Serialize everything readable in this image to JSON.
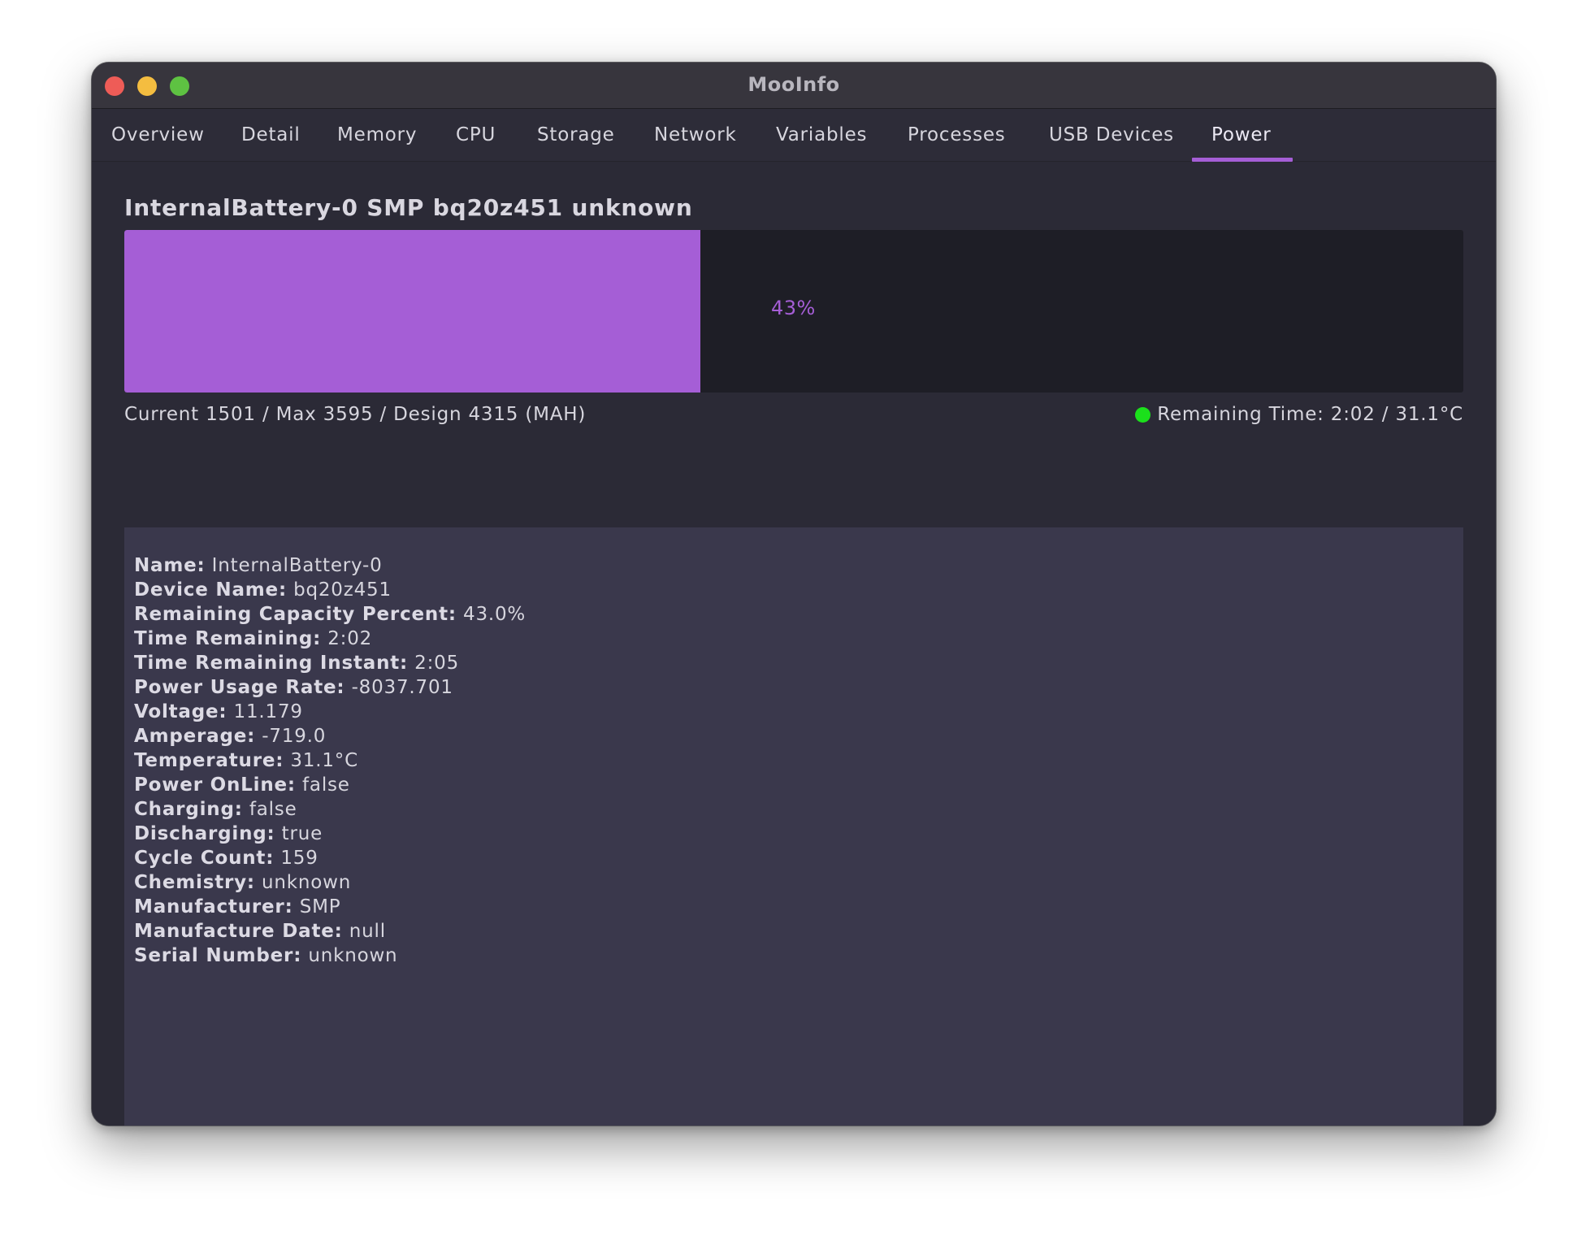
{
  "window": {
    "title": "MooInfo"
  },
  "tabs": [
    {
      "label": "Overview"
    },
    {
      "label": "Detail"
    },
    {
      "label": "Memory"
    },
    {
      "label": "CPU"
    },
    {
      "label": "Storage"
    },
    {
      "label": "Network"
    },
    {
      "label": "Variables"
    },
    {
      "label": "Processes"
    },
    {
      "label": "USB Devices"
    },
    {
      "label": "Power",
      "active": true
    }
  ],
  "battery": {
    "title": "InternalBattery-0 SMP bq20z451 unknown",
    "percent": 43,
    "percent_label": "43%",
    "capacity_text": "Current 1501 / Max 3595 / Design 4315 (MAH)",
    "remaining_text": "Remaining Time: 2:02 / 31.1°C",
    "status_color": "#1be01b",
    "fill_color": "#a55ed6"
  },
  "details": [
    {
      "key": "Name:",
      "value": "InternalBattery-0"
    },
    {
      "key": "Device Name:",
      "value": "bq20z451"
    },
    {
      "key": "Remaining Capacity Percent:",
      "value": "43.0%"
    },
    {
      "key": "Time Remaining:",
      "value": "2:02"
    },
    {
      "key": "Time Remaining Instant:",
      "value": "2:05"
    },
    {
      "key": "Power Usage Rate:",
      "value": "-8037.701"
    },
    {
      "key": "Voltage:",
      "value": "11.179"
    },
    {
      "key": "Amperage:",
      "value": "-719.0"
    },
    {
      "key": "Temperature:",
      "value": "31.1°C"
    },
    {
      "key": "Power OnLine:",
      "value": "false"
    },
    {
      "key": "Charging:",
      "value": "false"
    },
    {
      "key": "Discharging:",
      "value": "true"
    },
    {
      "key": "Cycle Count:",
      "value": "159"
    },
    {
      "key": "Chemistry:",
      "value": "unknown"
    },
    {
      "key": "Manufacturer:",
      "value": "SMP"
    },
    {
      "key": "Manufacture Date:",
      "value": "null"
    },
    {
      "key": "Serial Number:",
      "value": "unknown"
    }
  ]
}
